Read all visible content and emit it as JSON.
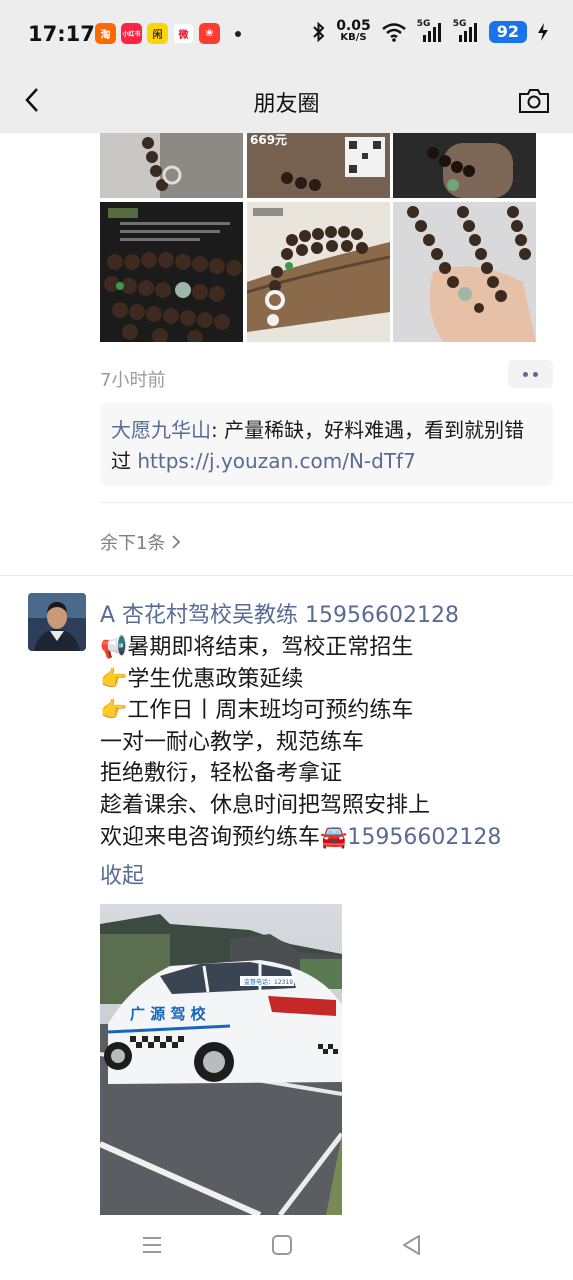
{
  "status_bar": {
    "time": "17:17",
    "app_icons": [
      {
        "name": "taobao-icon",
        "glyph": "淘",
        "color": "#ff6a00"
      },
      {
        "name": "xiaohongshu-icon",
        "glyph": "小红书",
        "color": "#ff2442"
      },
      {
        "name": "xianyu-icon",
        "glyph": "闲",
        "color": "#ffd400"
      },
      {
        "name": "weibo-icon",
        "glyph": "微",
        "color": "#e6162d"
      },
      {
        "name": "app-icon-red",
        "glyph": "❀",
        "color": "#ff3b30"
      }
    ],
    "net_speed_value": "0.05",
    "net_speed_unit": "KB/S",
    "signal1_label": "5G",
    "signal2_label": "5G",
    "battery": "92"
  },
  "nav": {
    "title": "朋友圈"
  },
  "prev_post": {
    "price_tag": "669元",
    "time": "7小时前",
    "comment": {
      "author": "大愿九华山",
      "separator": ": ",
      "text": "产量稀缺，好料难遇，看到就别错过 ",
      "link": "https://j.youzan.com/N-dTf7"
    },
    "remaining": "余下1条"
  },
  "post": {
    "author": "A 杏花村驾校吴教练 15956602128",
    "lines": [
      "📢暑期即将结束，驾校正常招生",
      "👉学生优惠政策延续",
      "👉工作日丨周末班均可预约练车",
      "一对一耐心教学，规范练车",
      "拒绝敷衍，轻松备考拿证",
      "趁着课余、休息时间把驾照安排上"
    ],
    "last_line_text": "欢迎来电咨询预约练车🚘",
    "last_line_phone": "15956602128",
    "collapse": "收起",
    "car_sign": "广 源 驾 校",
    "car_phone_sign": "监督电话：12319"
  }
}
